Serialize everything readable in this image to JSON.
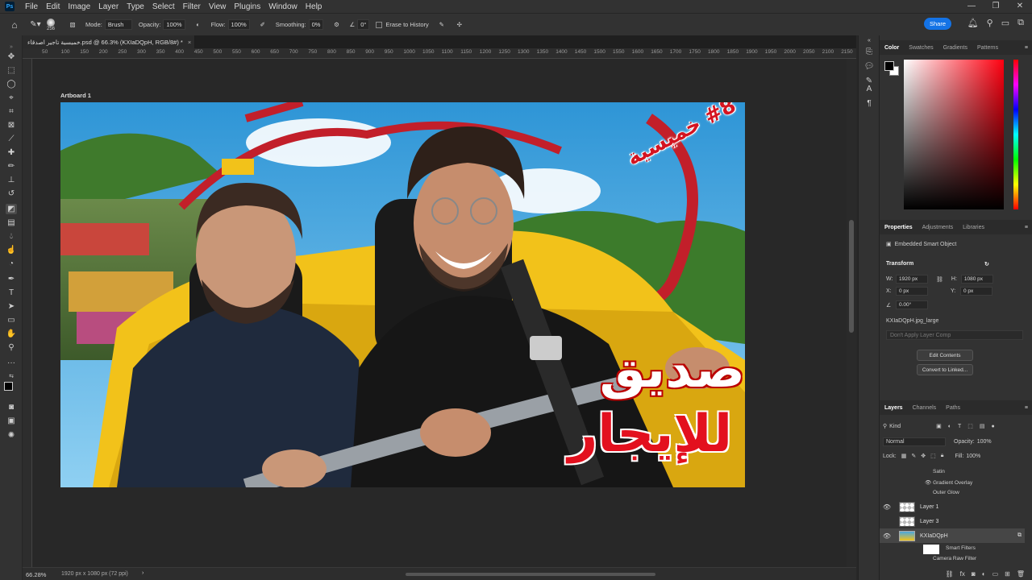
{
  "menubar": {
    "items": [
      "File",
      "Edit",
      "Image",
      "Layer",
      "Type",
      "Select",
      "Filter",
      "View",
      "Plugins",
      "Window",
      "Help"
    ]
  },
  "options_bar": {
    "brush_size": "256",
    "mode_label": "Mode:",
    "mode_value": "Brush",
    "opacity_label": "Opacity:",
    "opacity_value": "100%",
    "flow_label": "Flow:",
    "flow_value": "100%",
    "smoothing_label": "Smoothing:",
    "smoothing_value": "0%",
    "angle_value": "0°",
    "erase_history_label": "Erase to History",
    "share_label": "Share"
  },
  "document": {
    "tab_title": "خميسية تاجير اصدقاء.psd @ 66.3% (KXIaDQpH, RGB/8#) *",
    "artboard_label": "Artboard 1",
    "zoom": "66.28%",
    "doc_info": "1920 px x 1080 px (72 ppi)",
    "ruler_ticks": [
      "50",
      "100",
      "150",
      "200",
      "250",
      "300",
      "350",
      "400",
      "450",
      "500",
      "550",
      "600",
      "650",
      "700",
      "750",
      "800",
      "850",
      "900",
      "950",
      "1000",
      "1050",
      "1100",
      "1150",
      "1200",
      "1250",
      "1300",
      "1350",
      "1400",
      "1450",
      "1500",
      "1550",
      "1600",
      "1650",
      "1700",
      "1750",
      "1800",
      "1850",
      "1900",
      "1950",
      "2000",
      "2050",
      "2100",
      "2150"
    ]
  },
  "artwork": {
    "badge_text": "#8 خميسية",
    "title_line1": "صديق",
    "title_line2": "للإيجار"
  },
  "color_panel": {
    "tabs": [
      "Color",
      "Swatches",
      "Gradients",
      "Patterns"
    ]
  },
  "properties_panel": {
    "tabs": [
      "Properties",
      "Adjustments",
      "Libraries"
    ],
    "object_type": "Embedded Smart Object",
    "transform_label": "Transform",
    "w_label": "W:",
    "w_value": "1920 px",
    "h_label": "H:",
    "h_value": "1080 px",
    "x_label": "X:",
    "x_value": "0 px",
    "y_label": "Y:",
    "y_value": "0 px",
    "angle_value": "0.00°",
    "filename": "KXIaDQpH.jpg_large",
    "layer_comp": "Don't Apply Layer Comp",
    "edit_contents": "Edit Contents",
    "convert_linked": "Convert to Linked..."
  },
  "layers_panel": {
    "tabs": [
      "Layers",
      "Channels",
      "Paths"
    ],
    "filter_kind": "Kind",
    "blend_mode": "Normal",
    "opacity_label": "Opacity:",
    "opacity_value": "100%",
    "lock_label": "Lock:",
    "fill_label": "Fill:",
    "fill_value": "100%",
    "effects": [
      "Satin",
      "Gradient Overlay",
      "Outer Glow"
    ],
    "layers": [
      {
        "name": "Layer 1",
        "visible": true
      },
      {
        "name": "Layer 3",
        "visible": false
      },
      {
        "name": "KXIaDQpH",
        "visible": true
      }
    ],
    "smart_filters_label": "Smart Filters",
    "camera_raw_label": "Camera Raw Filter"
  },
  "colors": {
    "accent": "#1473e6",
    "title_red": "#e3101e",
    "coaster_yellow": "#f2c21a",
    "sky": "#4aa8e0"
  }
}
